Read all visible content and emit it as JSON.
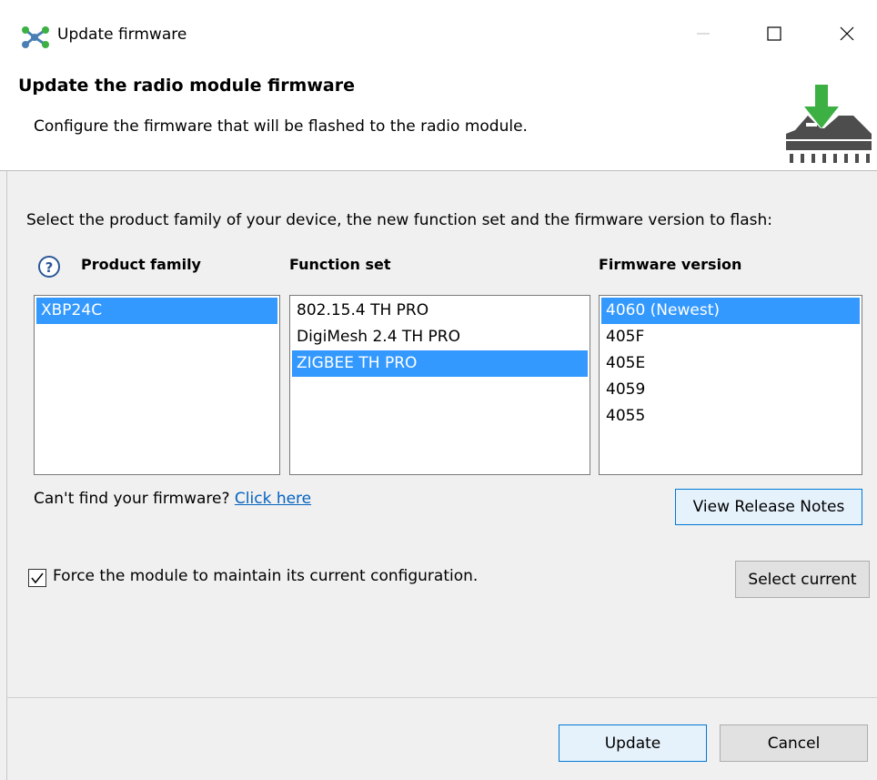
{
  "window": {
    "title": "Update firmware",
    "icons": [
      "app-network-icon",
      "minimize-icon",
      "maximize-icon",
      "close-icon"
    ]
  },
  "header": {
    "title": "Update the radio module firmware",
    "subtitle": "Configure the firmware that will be flashed to the radio module.",
    "icon": "chip-download-icon"
  },
  "instructions": "Select the product family of your device, the new function set and the firmware version to flash:",
  "columns": {
    "product_family": "Product family",
    "function_set": "Function set",
    "firmware_version": "Firmware version"
  },
  "product_families": [
    {
      "label": "XBP24C",
      "selected": true
    }
  ],
  "function_sets": [
    {
      "label": "802.15.4 TH PRO",
      "selected": false
    },
    {
      "label": "DigiMesh 2.4 TH PRO",
      "selected": false
    },
    {
      "label": "ZIGBEE TH PRO",
      "selected": true
    }
  ],
  "firmware_versions": [
    {
      "label": "4060 (Newest)",
      "selected": true
    },
    {
      "label": "405F",
      "selected": false
    },
    {
      "label": "405E",
      "selected": false
    },
    {
      "label": "4059",
      "selected": false
    },
    {
      "label": "4055",
      "selected": false
    }
  ],
  "cant_find": {
    "text": "Can't find your firmware?",
    "link": "Click here"
  },
  "buttons": {
    "view_release_notes": "View Release Notes",
    "select_current": "Select current",
    "update": "Update",
    "cancel": "Cancel"
  },
  "force_config": {
    "label": "Force the module to maintain its current configuration.",
    "checked": true
  },
  "colors": {
    "selection": "#3399ff",
    "link": "#0563c1",
    "icon_green": "#3cb043",
    "focus_border": "#0078d7"
  }
}
